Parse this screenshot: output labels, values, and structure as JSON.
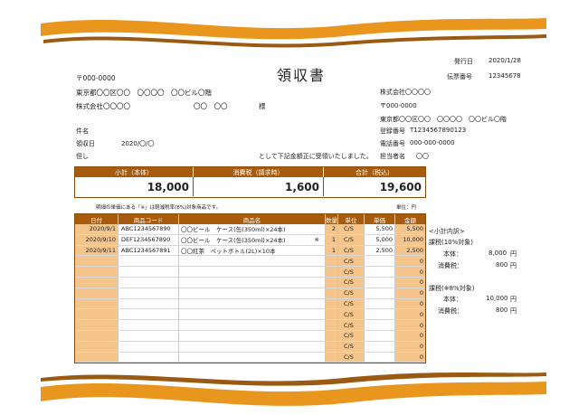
{
  "document": {
    "title": "領収書",
    "issue_date_label": "発行日",
    "issue_date": "2020/1/28",
    "slip_number_label": "伝票番号",
    "slip_number": "12345678"
  },
  "recipient": {
    "postal": "〒000-0000",
    "address": "東京都〇〇区〇〇　〇〇〇〇　〇〇ビル〇階",
    "company": "株式会社〇〇〇〇",
    "person": "〇〇　〇〇",
    "honorific": "様"
  },
  "issuer": {
    "company": "株式会社〇〇〇〇",
    "postal": "〒000-0000",
    "address": "東京都〇〇区〇〇　〇〇〇〇　〇〇ビル〇階",
    "registration_label": "登録番号",
    "registration": "T1234567890123",
    "phone_label": "電話番号",
    "phone": "000-000-0000",
    "contact_label": "担当者名",
    "contact": "〇〇"
  },
  "meta": {
    "subject_label": "件名",
    "received_date_label": "領収日",
    "received_date": "2020/〇/〇",
    "proviso_label": "但し",
    "receipt_statement": "として下記金額正に受領いたしました。"
  },
  "summary": {
    "subtotal_label": "小計（本体）",
    "tax_label": "消費税（請求時）",
    "total_label": "合計（税込）",
    "subtotal": "18,000",
    "tax": "1,600",
    "total": "19,600"
  },
  "notes": {
    "reduced_rate_note": "明細の単価にある「※」は軽減税率(8%)対象商品です。",
    "unit_note": "単位：円"
  },
  "items_table": {
    "headers": [
      "日付",
      "商品コード",
      "商品名",
      "数量",
      "単位",
      "単価",
      "金額"
    ],
    "rows": [
      {
        "date": "2020/9/1",
        "code": "ABC1234567890",
        "name": "〇〇ビール　ケース(缶(350ml)×24本)",
        "mark": "",
        "qty": "2",
        "unit": "C/S",
        "price": "5,500",
        "amount": "5,500"
      },
      {
        "date": "2020/9/10",
        "code": "DEF1234567890",
        "name": "〇〇ビール　ケース(缶(350ml)×24本)",
        "mark": "※",
        "qty": "1",
        "unit": "C/S",
        "price": "5,000",
        "amount": "10,000"
      },
      {
        "date": "2020/9/11",
        "code": "ABC1234567891",
        "name": "〇〇紅茶　ペットボトル(2L)×10本",
        "mark": "",
        "qty": "1",
        "unit": "C/S",
        "price": "2,500",
        "amount": "2,500"
      },
      {
        "date": "",
        "code": "",
        "name": "",
        "mark": "",
        "qty": "",
        "unit": "C/S",
        "price": "",
        "amount": "0"
      },
      {
        "date": "",
        "code": "",
        "name": "",
        "mark": "",
        "qty": "",
        "unit": "C/S",
        "price": "",
        "amount": "0"
      },
      {
        "date": "",
        "code": "",
        "name": "",
        "mark": "",
        "qty": "",
        "unit": "C/S",
        "price": "",
        "amount": "0"
      },
      {
        "date": "",
        "code": "",
        "name": "",
        "mark": "",
        "qty": "",
        "unit": "C/S",
        "price": "",
        "amount": "0"
      },
      {
        "date": "",
        "code": "",
        "name": "",
        "mark": "",
        "qty": "",
        "unit": "C/S",
        "price": "",
        "amount": "0"
      },
      {
        "date": "",
        "code": "",
        "name": "",
        "mark": "",
        "qty": "",
        "unit": "C/S",
        "price": "",
        "amount": "0"
      },
      {
        "date": "",
        "code": "",
        "name": "",
        "mark": "",
        "qty": "",
        "unit": "C/S",
        "price": "",
        "amount": "0"
      },
      {
        "date": "",
        "code": "",
        "name": "",
        "mark": "",
        "qty": "",
        "unit": "C/S",
        "price": "",
        "amount": "0"
      },
      {
        "date": "",
        "code": "",
        "name": "",
        "mark": "",
        "qty": "",
        "unit": "C/S",
        "price": "",
        "amount": "0"
      },
      {
        "date": "",
        "code": "",
        "name": "",
        "mark": "",
        "qty": "",
        "unit": "C/S",
        "price": "",
        "amount": "0"
      }
    ]
  },
  "breakdown": {
    "title": "<小計内訳>",
    "rate10_label": "課税(10%対象)",
    "rate10_base_label": "本体：",
    "rate10_base": "8,000",
    "rate10_tax_label": "消費税：",
    "rate10_tax": "800",
    "rate8_label": "課税(※8%対象)",
    "rate8_base_label": "本体：",
    "rate8_base": "10,000",
    "rate8_tax_label": "消費税：",
    "rate8_tax": "800",
    "currency": "円"
  },
  "colors": {
    "accent_dark": "#a65c0c",
    "accent_light": "#f6c58c",
    "wave": "#e8961e"
  }
}
